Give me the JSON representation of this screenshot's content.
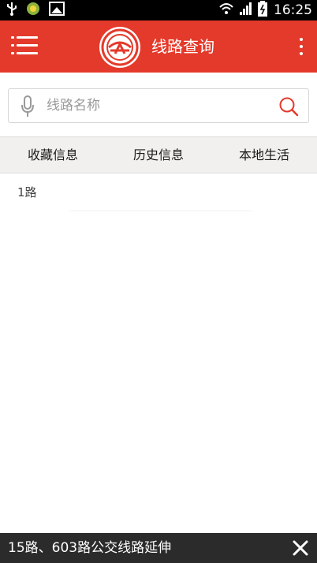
{
  "status_bar": {
    "time": "16:25",
    "icons": [
      "usb-icon",
      "app-notification-icon",
      "screenshot-icon",
      "wifi-icon",
      "signal-icon",
      "battery-icon"
    ]
  },
  "app_bar": {
    "title": "线路查询",
    "logo": "bus-company-logo",
    "menu_icon": "hamburger-menu-icon",
    "more_icon": "overflow-menu-icon"
  },
  "search": {
    "placeholder": "线路名称",
    "value": "",
    "mic_icon": "microphone-icon",
    "search_icon": "search-icon"
  },
  "tabs": [
    {
      "label": "收藏信息"
    },
    {
      "label": "历史信息"
    },
    {
      "label": "本地生活"
    }
  ],
  "routes": [
    {
      "label": "1路"
    }
  ],
  "notice": {
    "text": "15路、603路公交线路延伸",
    "close_icon": "close-icon"
  },
  "colors": {
    "brand": "#e43a2b",
    "tab_bg": "#f1f0ee",
    "notice_bg": "#2b2b2b",
    "status_bg": "#000000"
  }
}
